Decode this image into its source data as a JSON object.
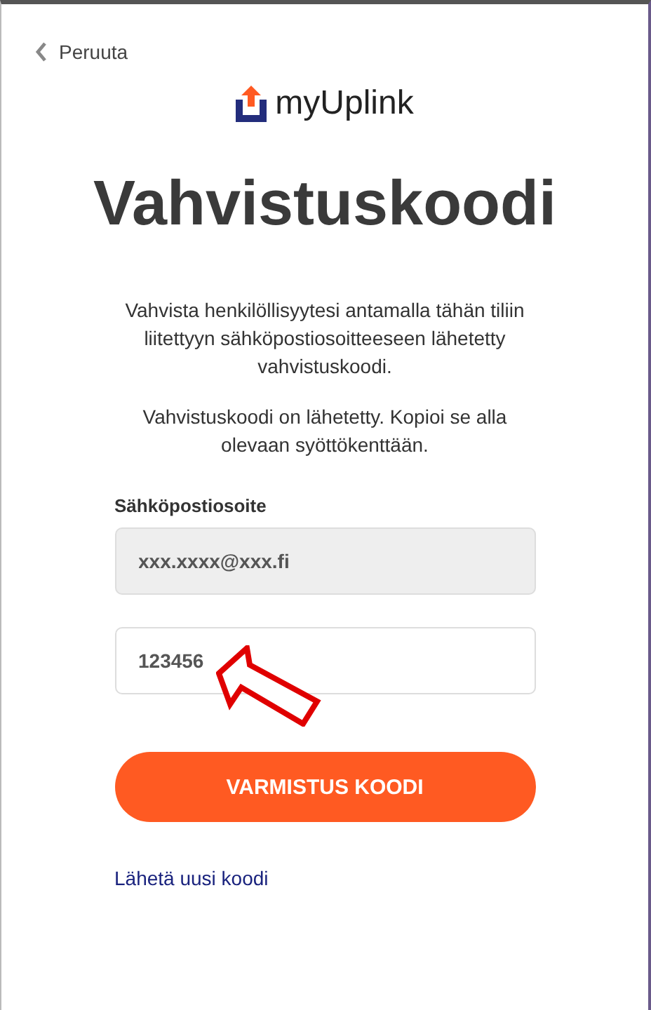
{
  "back": {
    "label": "Peruuta"
  },
  "logo": {
    "text": "myUplink"
  },
  "title": "Vahvistuskoodi",
  "paragraphs": [
    "Vahvista henkilöllisyytesi antamalla tähän tiliin liitettyyn sähköpostiosoitteeseen lähetetty vahvistuskoodi.",
    "Vahvistuskoodi on lähetetty. Kopioi se alla olevaan syöttökenttään."
  ],
  "fields": [
    {
      "label": "Sähköpostiosoite",
      "value": "xxx.xxxx@xxx.fi",
      "disabled": true
    },
    {
      "value": "123456",
      "disabled": false,
      "annotated": true
    }
  ],
  "button": {
    "label": "VARMISTUS KOODI"
  },
  "link": {
    "label": "Lähetä uusi koodi"
  }
}
